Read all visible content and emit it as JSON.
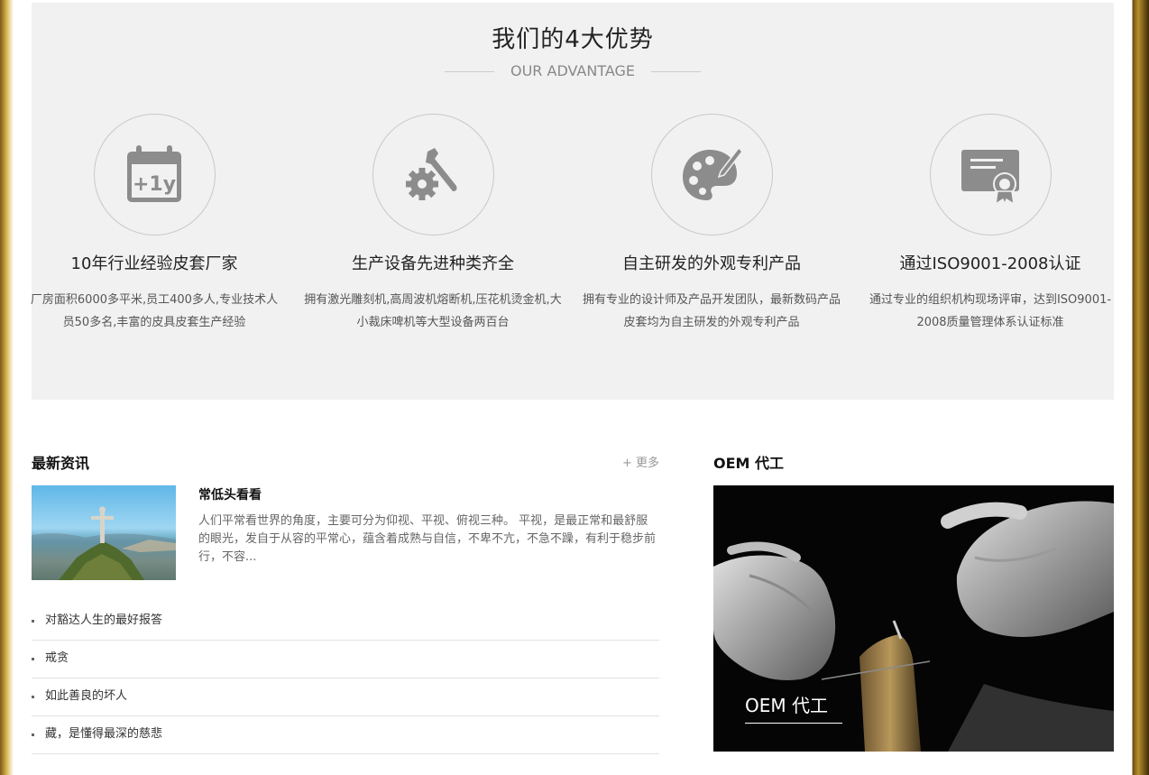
{
  "advantage": {
    "title": "我们的4大优势",
    "subtitle": "OUR ADVANTAGE",
    "items": [
      {
        "icon": "calendar-plus-1y-icon",
        "title": "10年行业经验皮套厂家",
        "desc": "厂房面积6000多平米,员工400多人,专业技术人员50多名,丰富的皮具皮套生产经验"
      },
      {
        "icon": "gear-wrench-icon",
        "title": "生产设备先进种类齐全",
        "desc": "拥有激光雕刻机,高周波机熔断机,压花机烫金机,大小裁床啤机等大型设备两百台"
      },
      {
        "icon": "palette-brush-icon",
        "title": "自主研发的外观专利产品",
        "desc": "拥有专业的设计师及产品开发团队，最新数码产品皮套均为自主研发的外观专利产品"
      },
      {
        "icon": "certificate-icon",
        "title": "通过ISO9001-2008认证",
        "desc": "通过专业的组织机构现场评审，达到ISO9001-2008质量管理体系认证标准"
      }
    ]
  },
  "news": {
    "title": "最新资讯",
    "more": "+ 更多",
    "feature": {
      "title": "常低头看看",
      "desc": "人们平常看世界的角度，主要可分为仰视、平视、俯视三种。 平视，是最正常和最舒服的眼光，发自于从容的平常心，蕴含着成熟与自信，不卑不亢，不急不躁，有利于稳步前行，不容..."
    },
    "items": [
      "对豁达人生的最好报答",
      "戒贪",
      "如此善良的坏人",
      "藏，是懂得最深的慈悲"
    ]
  },
  "oem": {
    "title": "OEM 代工",
    "caption": "OEM 代工"
  },
  "colors": {
    "icon_gray": "#8c8c8c",
    "section_bg": "#f1f1f1"
  }
}
